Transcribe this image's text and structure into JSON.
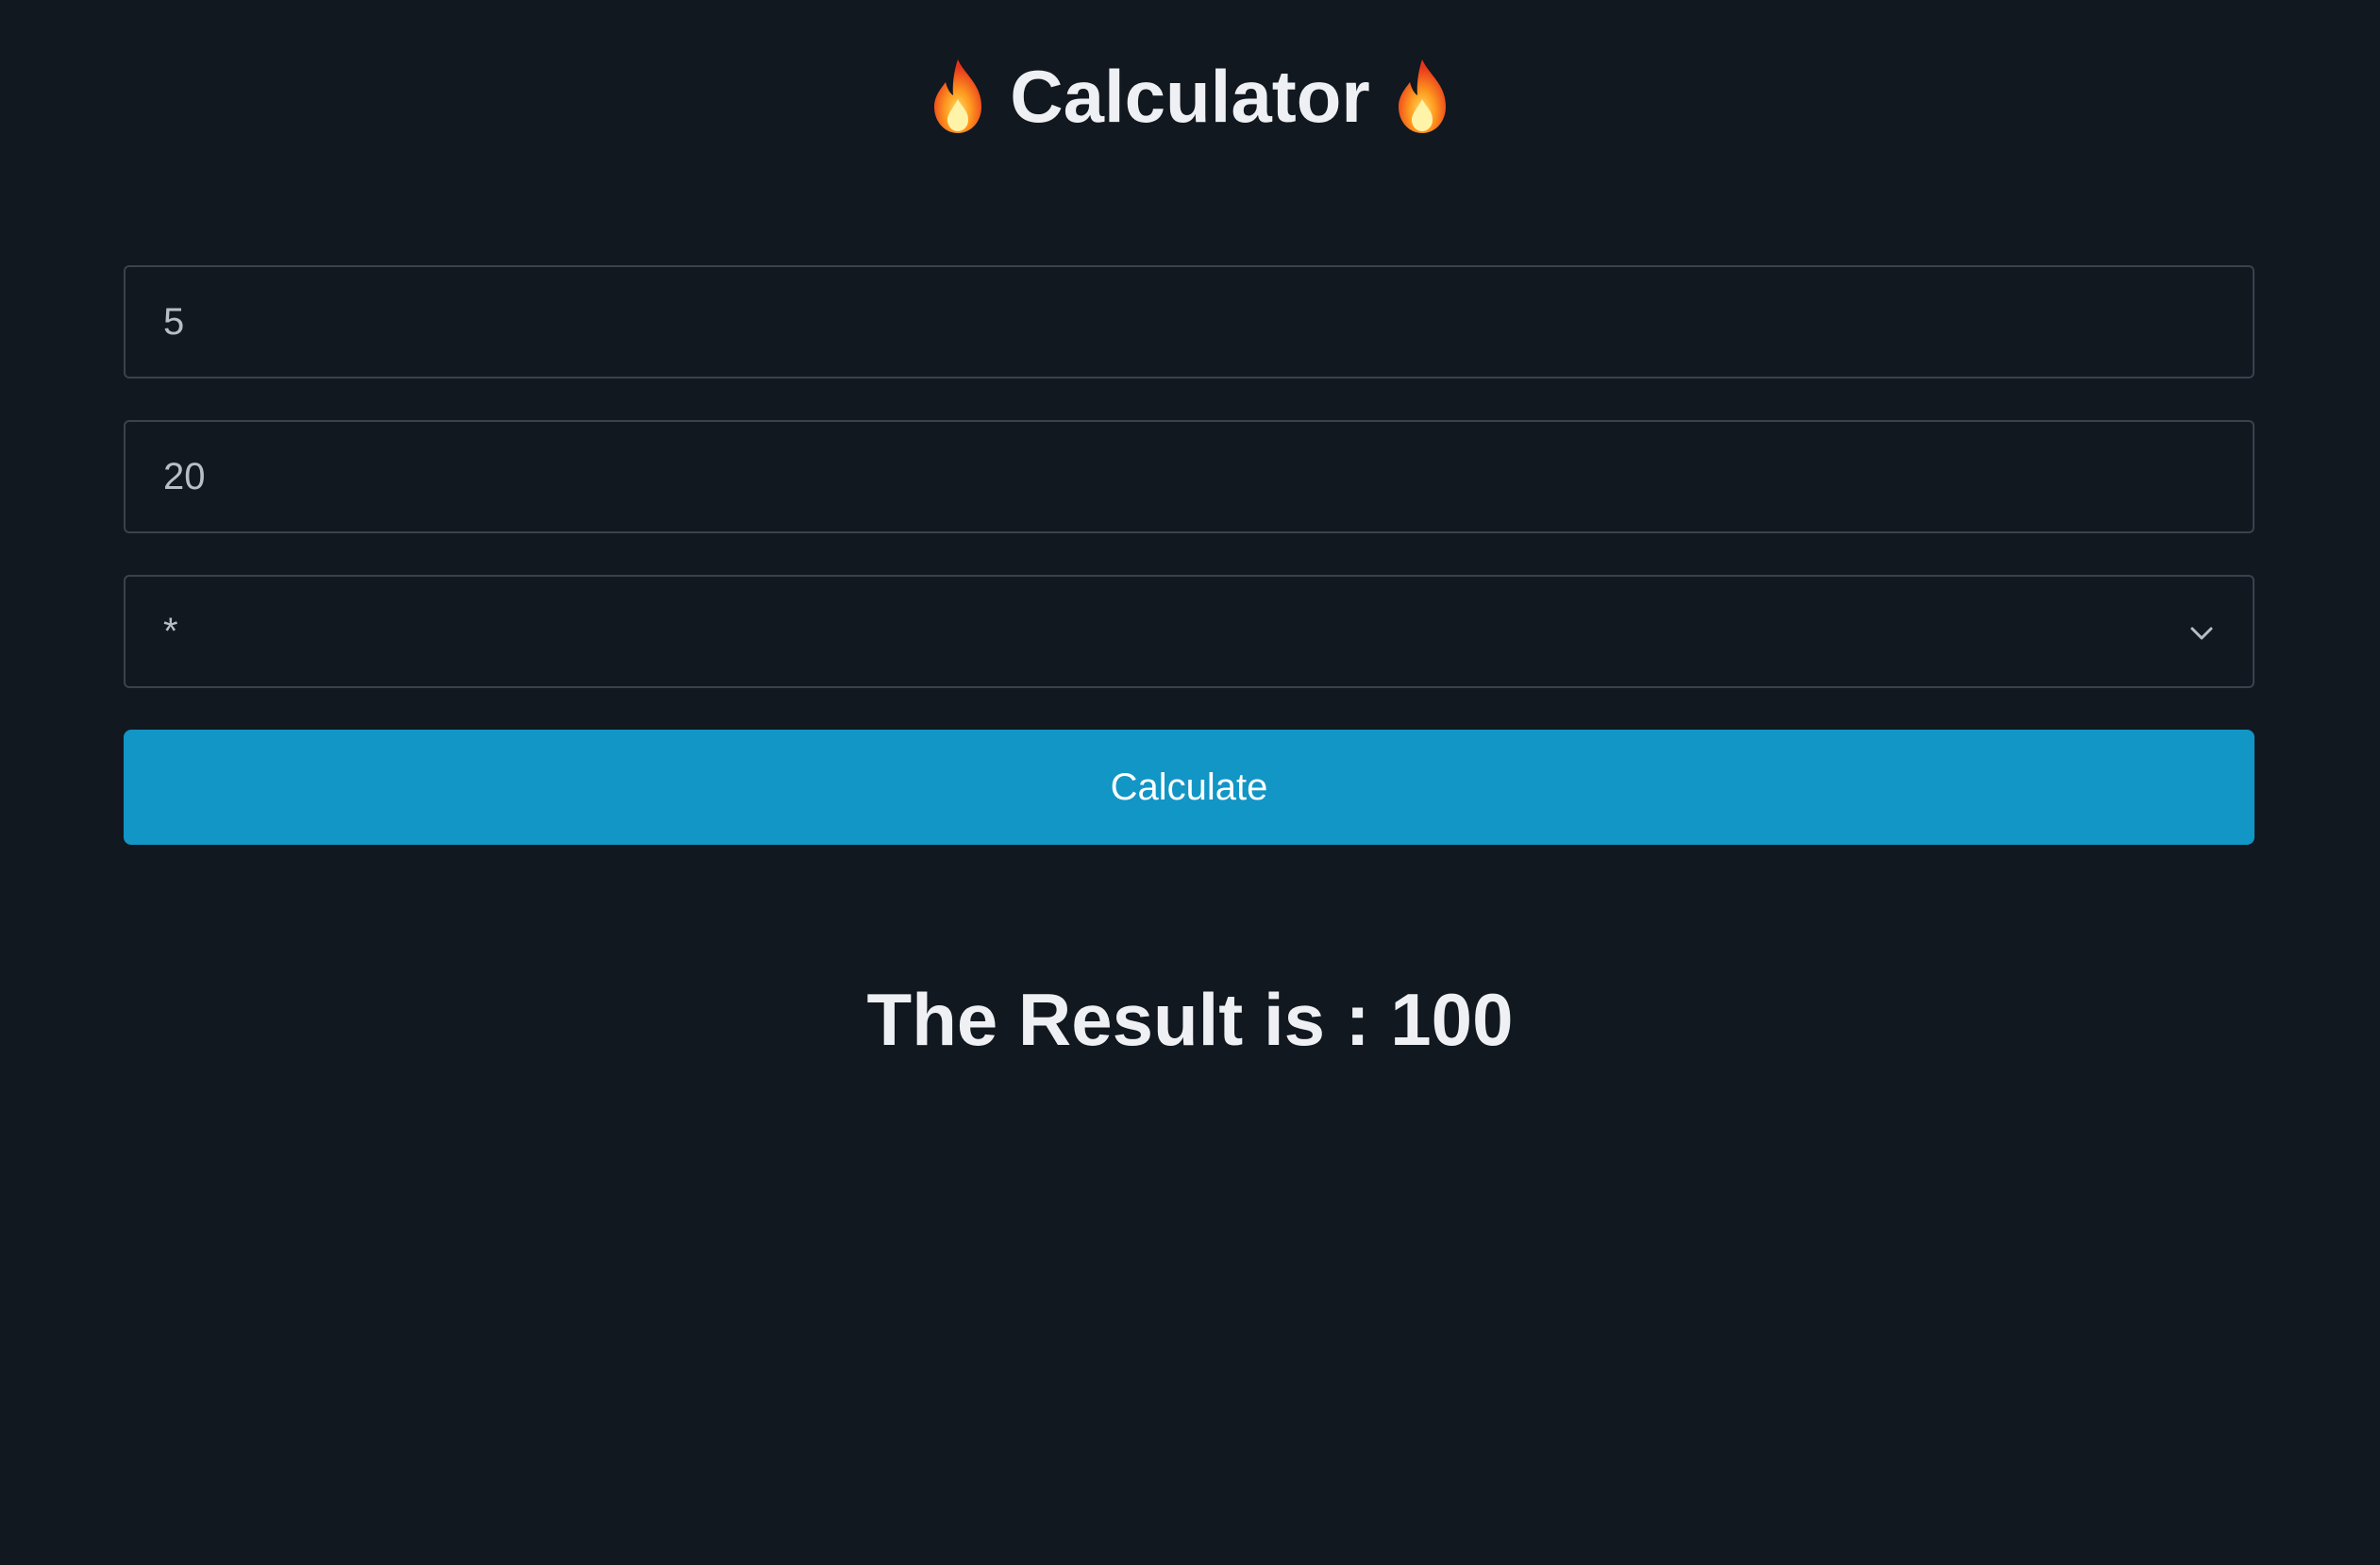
{
  "header": {
    "title": "Calculator",
    "left_icon": "fire-emoji",
    "right_icon": "fire-emoji"
  },
  "form": {
    "first_number": "5",
    "second_number": "20",
    "operator": "*",
    "calculate_label": "Calculate"
  },
  "result": {
    "text": "The Result is : 100"
  },
  "colors": {
    "background": "#121820",
    "button": "#1196c5",
    "text": "#eef0f3"
  }
}
